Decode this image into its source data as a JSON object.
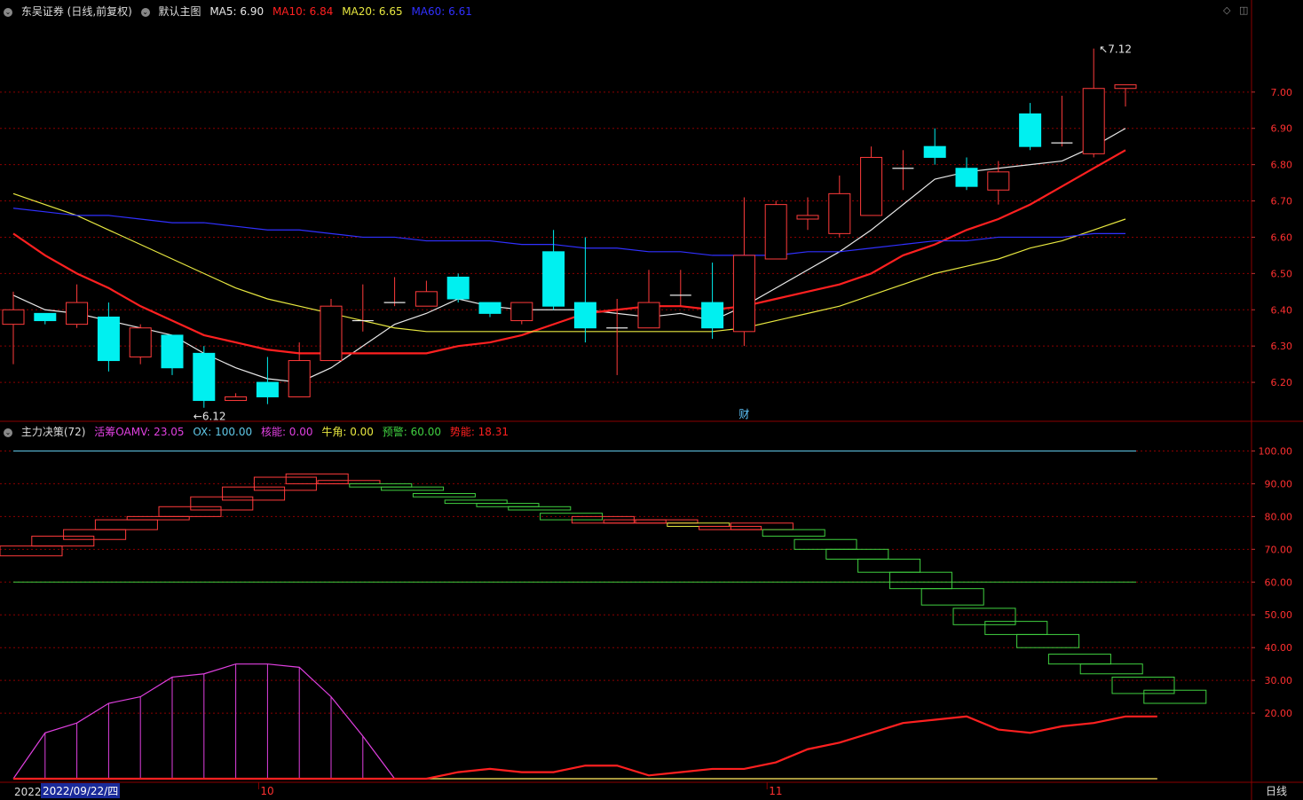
{
  "header": {
    "title": "东吴证券 (日线,前复权)",
    "template": "默认主图",
    "ma": [
      {
        "label": "MA5: 6.90",
        "color": "#e8e8e8"
      },
      {
        "label": "MA10: 6.84",
        "color": "#ff2020"
      },
      {
        "label": "MA20: 6.65",
        "color": "#e8e840"
      },
      {
        "label": "MA60: 6.61",
        "color": "#3030ff"
      }
    ]
  },
  "sub_header": {
    "title": "主力决策(72)",
    "items": [
      {
        "label": "活筹OAMV: 23.05",
        "color": "#e040e0"
      },
      {
        "label": "OX: 100.00",
        "color": "#60c8e8"
      },
      {
        "label": "核能: 0.00",
        "color": "#e040e0"
      },
      {
        "label": "牛角: 0.00",
        "color": "#e8e840"
      },
      {
        "label": "预警: 60.00",
        "color": "#40d040"
      },
      {
        "label": "势能: 18.31",
        "color": "#ff2020"
      }
    ]
  },
  "footer": {
    "year": "2022",
    "cursor_date": "2022/09/22/四",
    "month_labels": [
      "10",
      "11"
    ],
    "period": "日线"
  },
  "annotations": {
    "high_label": "7.12",
    "low_label": "6.12",
    "event_marker": "财"
  },
  "colors": {
    "up": "#ff3b3b",
    "down": "#00f0f0",
    "background": "#000000",
    "grid": "#8b0000",
    "axis_text": "#ff3030"
  },
  "chart_data": [
    {
      "type": "candlestick",
      "title": "东吴证券 (日线,前复权)",
      "ylim": [
        6.1,
        7.2
      ],
      "y_ticks": [
        6.2,
        6.3,
        6.4,
        6.5,
        6.6,
        6.7,
        6.8,
        6.9,
        7.0
      ],
      "y_tick_labels": [
        "6.20",
        "6.30",
        "6.40",
        "6.50",
        "6.60",
        "6.70",
        "6.80",
        "6.90",
        "7.00"
      ],
      "candles": [
        {
          "o": 6.36,
          "h": 6.45,
          "l": 6.25,
          "c": 6.4
        },
        {
          "o": 6.39,
          "h": 6.39,
          "l": 6.36,
          "c": 6.37
        },
        {
          "o": 6.36,
          "h": 6.47,
          "l": 6.35,
          "c": 6.42
        },
        {
          "o": 6.38,
          "h": 6.42,
          "l": 6.23,
          "c": 6.26
        },
        {
          "o": 6.27,
          "h": 6.36,
          "l": 6.25,
          "c": 6.35
        },
        {
          "o": 6.33,
          "h": 6.33,
          "l": 6.22,
          "c": 6.24
        },
        {
          "o": 6.28,
          "h": 6.3,
          "l": 6.13,
          "c": 6.15
        },
        {
          "o": 6.15,
          "h": 6.17,
          "l": 6.15,
          "c": 6.16
        },
        {
          "o": 6.2,
          "h": 6.27,
          "l": 6.14,
          "c": 6.16
        },
        {
          "o": 6.16,
          "h": 6.31,
          "l": 6.16,
          "c": 6.26
        },
        {
          "o": 6.26,
          "h": 6.43,
          "l": 6.26,
          "c": 6.41
        },
        {
          "o": 6.37,
          "h": 6.47,
          "l": 6.34,
          "c": 6.37
        },
        {
          "o": 6.42,
          "h": 6.49,
          "l": 6.41,
          "c": 6.42
        },
        {
          "o": 6.41,
          "h": 6.48,
          "l": 6.41,
          "c": 6.45
        },
        {
          "o": 6.49,
          "h": 6.5,
          "l": 6.42,
          "c": 6.43
        },
        {
          "o": 6.42,
          "h": 6.42,
          "l": 6.38,
          "c": 6.39
        },
        {
          "o": 6.37,
          "h": 6.42,
          "l": 6.36,
          "c": 6.42
        },
        {
          "o": 6.56,
          "h": 6.62,
          "l": 6.4,
          "c": 6.41
        },
        {
          "o": 6.42,
          "h": 6.6,
          "l": 6.31,
          "c": 6.35
        },
        {
          "o": 6.35,
          "h": 6.43,
          "l": 6.22,
          "c": 6.35
        },
        {
          "o": 6.35,
          "h": 6.51,
          "l": 6.35,
          "c": 6.42
        },
        {
          "o": 6.44,
          "h": 6.51,
          "l": 6.41,
          "c": 6.44
        },
        {
          "o": 6.42,
          "h": 6.53,
          "l": 6.32,
          "c": 6.35
        },
        {
          "o": 6.34,
          "h": 6.71,
          "l": 6.3,
          "c": 6.55
        },
        {
          "o": 6.54,
          "h": 6.7,
          "l": 6.54,
          "c": 6.69
        },
        {
          "o": 6.65,
          "h": 6.71,
          "l": 6.62,
          "c": 6.66
        },
        {
          "o": 6.61,
          "h": 6.77,
          "l": 6.6,
          "c": 6.72
        },
        {
          "o": 6.66,
          "h": 6.85,
          "l": 6.66,
          "c": 6.82
        },
        {
          "o": 6.79,
          "h": 6.84,
          "l": 6.73,
          "c": 6.79
        },
        {
          "o": 6.85,
          "h": 6.9,
          "l": 6.8,
          "c": 6.82
        },
        {
          "o": 6.79,
          "h": 6.82,
          "l": 6.73,
          "c": 6.74
        },
        {
          "o": 6.73,
          "h": 6.81,
          "l": 6.69,
          "c": 6.78
        },
        {
          "o": 6.94,
          "h": 6.97,
          "l": 6.84,
          "c": 6.85
        },
        {
          "o": 6.86,
          "h": 6.99,
          "l": 6.85,
          "c": 6.86
        },
        {
          "o": 6.83,
          "h": 7.12,
          "l": 6.82,
          "c": 7.01
        },
        {
          "o": 7.01,
          "h": 7.02,
          "l": 6.96,
          "c": 7.02
        }
      ],
      "series": [
        {
          "name": "MA5",
          "color": "#e8e8e8",
          "values": [
            6.44,
            6.4,
            6.39,
            6.37,
            6.35,
            6.33,
            6.28,
            6.24,
            6.21,
            6.2,
            6.24,
            6.3,
            6.36,
            6.39,
            6.43,
            6.41,
            6.4,
            6.4,
            6.4,
            6.39,
            6.38,
            6.39,
            6.37,
            6.41,
            6.46,
            6.51,
            6.56,
            6.62,
            6.69,
            6.76,
            6.78,
            6.79,
            6.8,
            6.81,
            6.85,
            6.9
          ]
        },
        {
          "name": "MA10",
          "color": "#ff2020",
          "values": [
            6.61,
            6.55,
            6.5,
            6.46,
            6.41,
            6.37,
            6.33,
            6.31,
            6.29,
            6.28,
            6.28,
            6.28,
            6.28,
            6.28,
            6.3,
            6.31,
            6.33,
            6.36,
            6.39,
            6.4,
            6.41,
            6.41,
            6.4,
            6.41,
            6.43,
            6.45,
            6.47,
            6.5,
            6.55,
            6.58,
            6.62,
            6.65,
            6.69,
            6.74,
            6.79,
            6.84
          ]
        },
        {
          "name": "MA20",
          "color": "#e8e840",
          "values": [
            6.72,
            6.69,
            6.66,
            6.62,
            6.58,
            6.54,
            6.5,
            6.46,
            6.43,
            6.41,
            6.39,
            6.37,
            6.35,
            6.34,
            6.34,
            6.34,
            6.34,
            6.34,
            6.34,
            6.34,
            6.34,
            6.34,
            6.34,
            6.35,
            6.37,
            6.39,
            6.41,
            6.44,
            6.47,
            6.5,
            6.52,
            6.54,
            6.57,
            6.59,
            6.62,
            6.65
          ]
        },
        {
          "name": "MA60",
          "color": "#3030ff",
          "values": [
            6.68,
            6.67,
            6.66,
            6.66,
            6.65,
            6.64,
            6.64,
            6.63,
            6.62,
            6.62,
            6.61,
            6.6,
            6.6,
            6.59,
            6.59,
            6.59,
            6.58,
            6.58,
            6.57,
            6.57,
            6.56,
            6.56,
            6.55,
            6.55,
            6.55,
            6.56,
            6.56,
            6.57,
            6.58,
            6.59,
            6.59,
            6.6,
            6.6,
            6.6,
            6.61,
            6.61
          ]
        }
      ]
    },
    {
      "type": "indicator",
      "title": "主力决策(72)",
      "ylim": [
        0,
        105
      ],
      "y_ticks": [
        20,
        30,
        40,
        50,
        60,
        70,
        80,
        90,
        100
      ],
      "y_tick_labels": [
        "20.00",
        "30.00",
        "40.00",
        "50.00",
        "60.00",
        "70.00",
        "80.00",
        "90.00",
        "100.00"
      ],
      "ox_level": 100,
      "warning_level": 60,
      "boxes": [
        {
          "top": 71,
          "bottom": 68,
          "color": "#ff3b3b"
        },
        {
          "top": 74,
          "bottom": 71,
          "color": "#ff3b3b"
        },
        {
          "top": 76,
          "bottom": 73,
          "color": "#ff3b3b"
        },
        {
          "top": 79,
          "bottom": 76,
          "color": "#ff3b3b"
        },
        {
          "top": 80,
          "bottom": 79,
          "color": "#ff3b3b"
        },
        {
          "top": 83,
          "bottom": 80,
          "color": "#ff3b3b"
        },
        {
          "top": 86,
          "bottom": 82,
          "color": "#ff3b3b"
        },
        {
          "top": 89,
          "bottom": 85,
          "color": "#ff3b3b"
        },
        {
          "top": 92,
          "bottom": 88,
          "color": "#ff3b3b"
        },
        {
          "top": 93,
          "bottom": 90,
          "color": "#ff3b3b"
        },
        {
          "top": 91,
          "bottom": 90,
          "color": "#ff3b3b"
        },
        {
          "top": 90,
          "bottom": 89,
          "color": "#40d040"
        },
        {
          "top": 89,
          "bottom": 88,
          "color": "#40d040"
        },
        {
          "top": 87,
          "bottom": 86,
          "color": "#40d040"
        },
        {
          "top": 85,
          "bottom": 84,
          "color": "#40d040"
        },
        {
          "top": 84,
          "bottom": 83,
          "color": "#40d040"
        },
        {
          "top": 83,
          "bottom": 82,
          "color": "#40d040"
        },
        {
          "top": 81,
          "bottom": 79,
          "color": "#40d040"
        },
        {
          "top": 80,
          "bottom": 78,
          "color": "#ff3b3b"
        },
        {
          "top": 79,
          "bottom": 78,
          "color": "#ff3b3b"
        },
        {
          "top": 79,
          "bottom": 78,
          "color": "#ff3b3b"
        },
        {
          "top": 78,
          "bottom": 77,
          "color": "#e8e840"
        },
        {
          "top": 77,
          "bottom": 76,
          "color": "#ff3b3b"
        },
        {
          "top": 78,
          "bottom": 76,
          "color": "#ff3b3b"
        },
        {
          "top": 76,
          "bottom": 74,
          "color": "#40d040"
        },
        {
          "top": 73,
          "bottom": 70,
          "color": "#40d040"
        },
        {
          "top": 70,
          "bottom": 67,
          "color": "#40d040"
        },
        {
          "top": 67,
          "bottom": 63,
          "color": "#40d040"
        },
        {
          "top": 63,
          "bottom": 58,
          "color": "#40d040"
        },
        {
          "top": 58,
          "bottom": 53,
          "color": "#40d040"
        },
        {
          "top": 52,
          "bottom": 47,
          "color": "#40d040"
        },
        {
          "top": 48,
          "bottom": 44,
          "color": "#40d040"
        },
        {
          "top": 44,
          "bottom": 40,
          "color": "#40d040"
        },
        {
          "top": 38,
          "bottom": 35,
          "color": "#40d040"
        },
        {
          "top": 35,
          "bottom": 32,
          "color": "#40d040"
        },
        {
          "top": 31,
          "bottom": 26,
          "color": "#40d040"
        },
        {
          "top": 27,
          "bottom": 23,
          "color": "#40d040"
        }
      ],
      "series": [
        {
          "name": "核能",
          "color": "#e040e0",
          "values": [
            0,
            14,
            17,
            23,
            25,
            31,
            32,
            35,
            35,
            34,
            25,
            13,
            0,
            0,
            0,
            0,
            0,
            0,
            0,
            0,
            0,
            0,
            0,
            0,
            0,
            0,
            0,
            0,
            0,
            0,
            0,
            0,
            0,
            0,
            0,
            0,
            0
          ]
        },
        {
          "name": "势能",
          "color": "#ff2020",
          "values": [
            0,
            0,
            0,
            0,
            0,
            0,
            0,
            0,
            0,
            0,
            0,
            0,
            0,
            0,
            2,
            3,
            2,
            2,
            4,
            4,
            1,
            2,
            3,
            3,
            5,
            9,
            11,
            14,
            17,
            18,
            19,
            15,
            14,
            16,
            17,
            19,
            19
          ]
        },
        {
          "name": "牛角",
          "color": "#e8e840",
          "values": [
            0,
            0,
            0,
            0,
            0,
            0,
            0,
            0,
            0,
            0,
            0,
            0,
            0,
            0,
            0,
            0,
            0,
            0,
            0,
            0,
            0,
            0,
            0,
            0,
            0,
            0,
            0,
            0,
            0,
            0,
            0,
            0,
            0,
            0,
            0,
            0,
            0
          ]
        }
      ]
    }
  ]
}
